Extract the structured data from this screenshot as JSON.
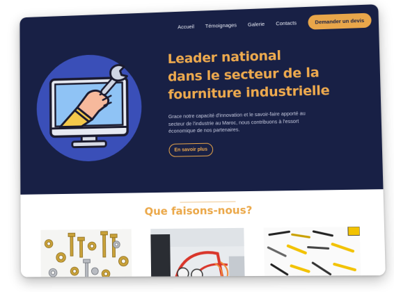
{
  "nav": {
    "items": [
      "Accueil",
      "Témoignages",
      "Galerie",
      "Contacts"
    ],
    "cta_label": "Demander un devis"
  },
  "hero": {
    "headline_lines": [
      "Leader national",
      "dans le secteur de la",
      "fourniture industrielle"
    ],
    "description_lines": [
      "Grace notre capacité d'innovation et le savoir-faire apporté au",
      "secteur de l'industrie au Maroc, nous contribuons à l'essort",
      "économique de nos partenaires."
    ],
    "button_label": "En savoir plus",
    "illustration_icon": "monitor-wrench-icon"
  },
  "services": {
    "title": "Que faisons-nous?",
    "images": [
      "bolts-nuts-image",
      "industrial-machine-image",
      "hand-tools-image"
    ]
  },
  "colors": {
    "navy": "#182045",
    "accent": "#e9a64a",
    "headline": "#eeaa4e"
  }
}
